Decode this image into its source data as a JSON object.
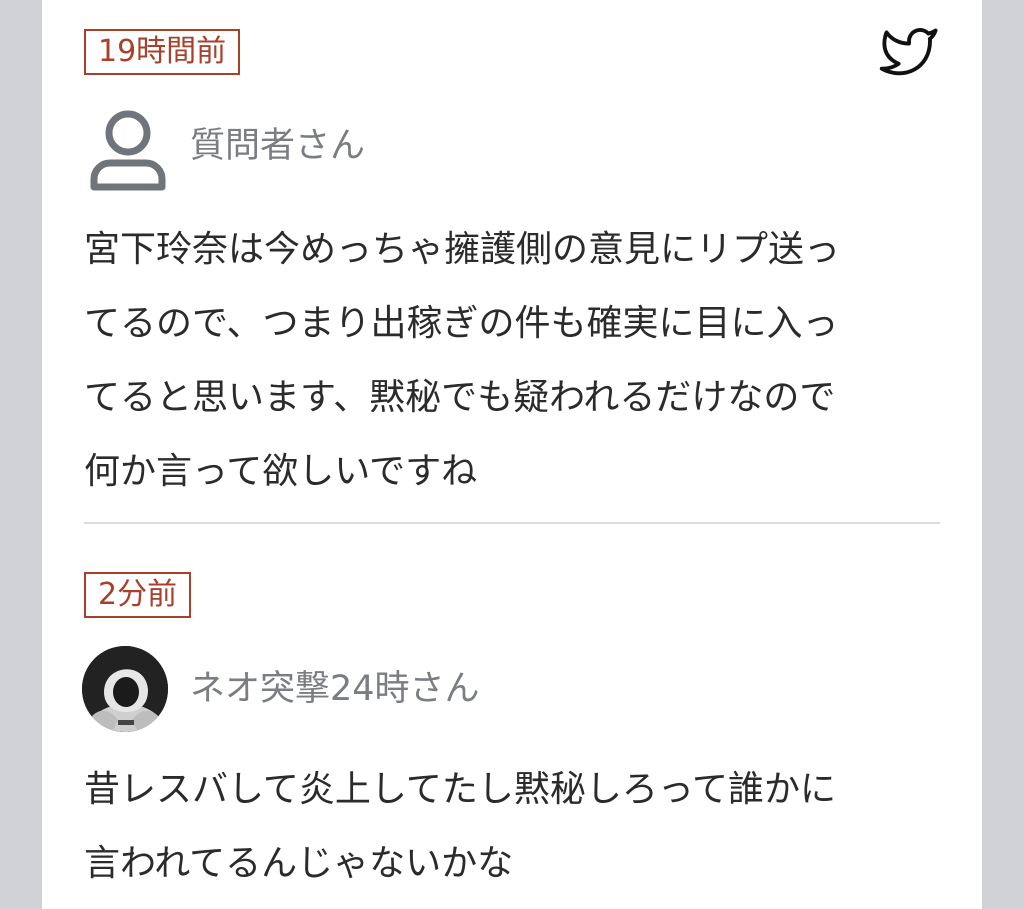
{
  "posts": [
    {
      "time": "19時間前",
      "username": "質問者さん",
      "avatar_icon": "user-outline-icon",
      "lines": [
        "宮下玲奈は今めっちゃ擁護側の意見にリプ送っ",
        "てるので、つまり出稼ぎの件も確実に目に入っ",
        "てると思います、黙秘でも疑われるだけなので",
        "何か言って欲しいですね"
      ]
    },
    {
      "time": "2分前",
      "username": "ネオ突撃24時さん",
      "avatar_icon": "hooded-figure-avatar",
      "lines": [
        "昔レスバして炎上してたし黙秘しろって誰かに",
        "言われてるんじゃないかな"
      ]
    }
  ],
  "share_icon": "twitter-icon",
  "colors": {
    "badge": "#a8402c",
    "username": "#7a7d82",
    "text": "#2b2b2b",
    "background": "#d1d2d6"
  }
}
